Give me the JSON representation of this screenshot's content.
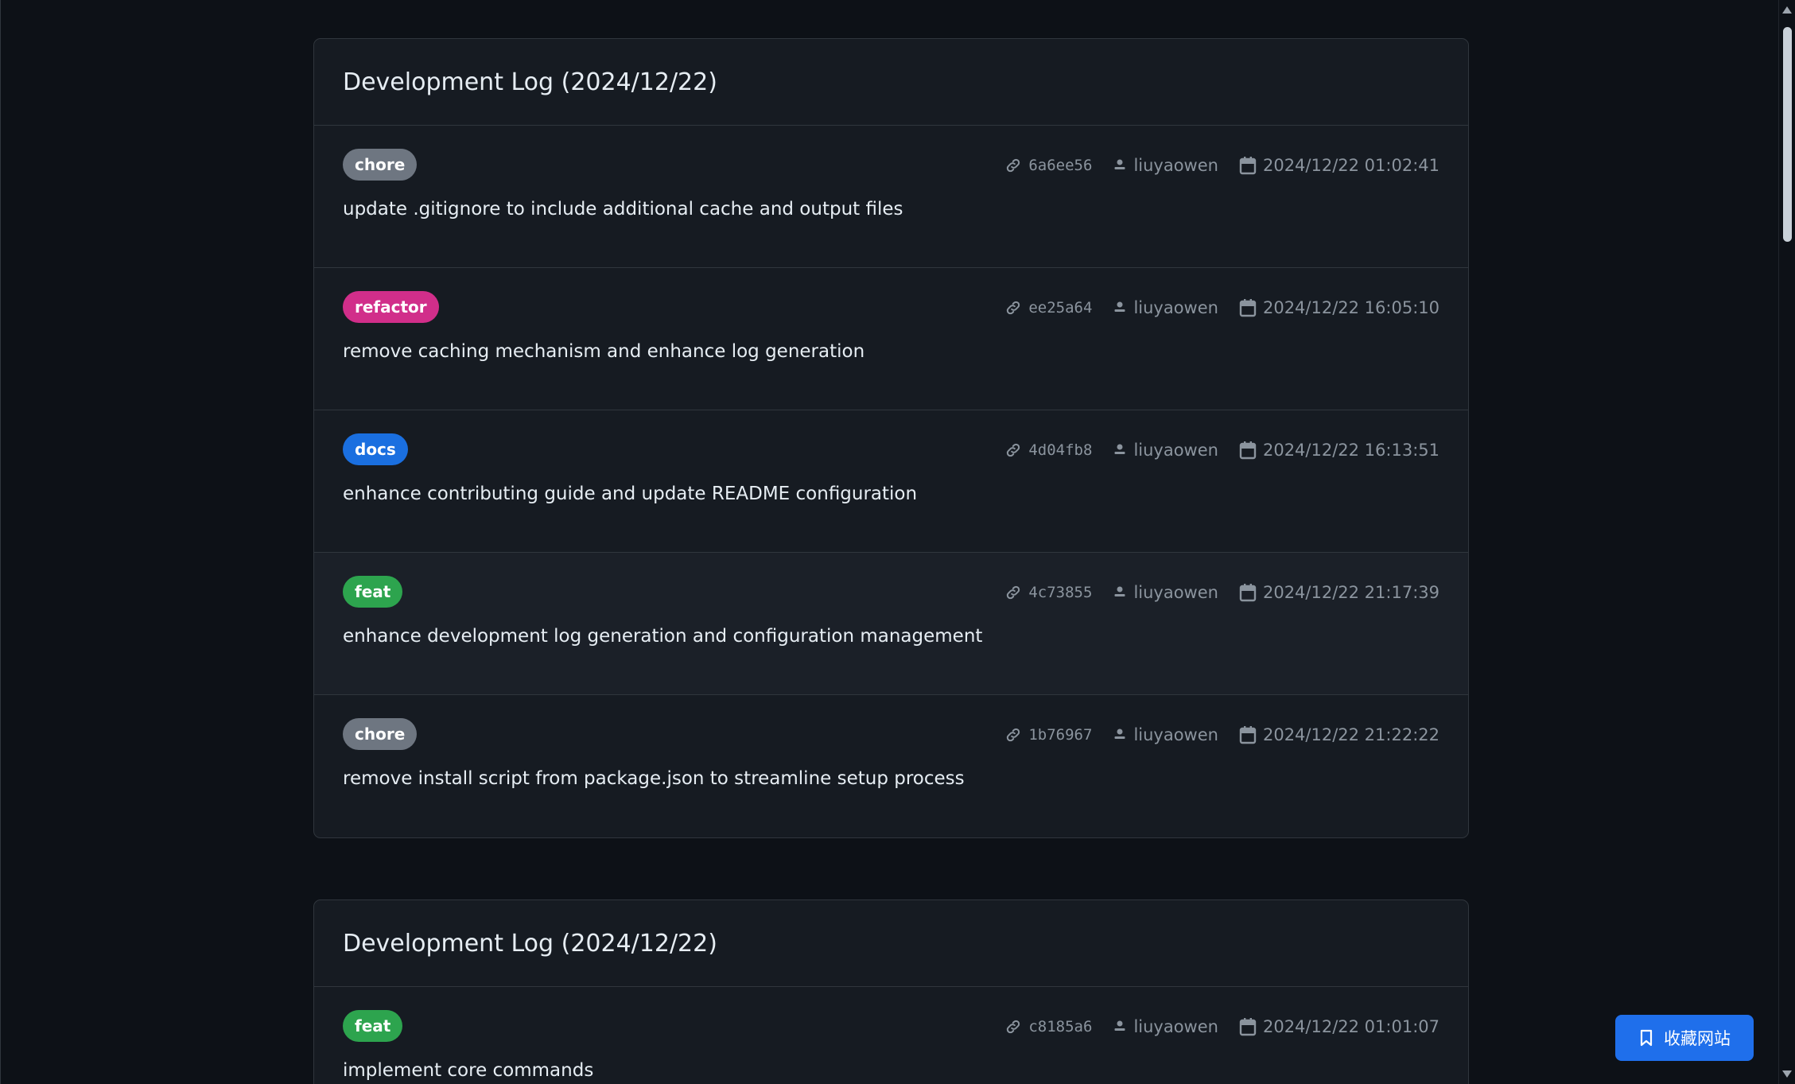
{
  "tag_colors": {
    "chore": "#6e7681",
    "refactor": "#d12e8a",
    "docs": "#1a6fe0",
    "feat": "#2da44e"
  },
  "logs": [
    {
      "title": "Development Log (2024/12/22)",
      "entries": [
        {
          "tag": "chore",
          "hash": "6a6ee56",
          "author": "liuyaowen",
          "date": "2024/12/22 01:02:41",
          "message": "update .gitignore to include additional cache and output files"
        },
        {
          "tag": "refactor",
          "hash": "ee25a64",
          "author": "liuyaowen",
          "date": "2024/12/22 16:05:10",
          "message": "remove caching mechanism and enhance log generation"
        },
        {
          "tag": "docs",
          "hash": "4d04fb8",
          "author": "liuyaowen",
          "date": "2024/12/22 16:13:51",
          "message": "enhance contributing guide and update README configuration"
        },
        {
          "tag": "feat",
          "hash": "4c73855",
          "author": "liuyaowen",
          "date": "2024/12/22 21:17:39",
          "message": "enhance development log generation and configuration management"
        },
        {
          "tag": "chore",
          "hash": "1b76967",
          "author": "liuyaowen",
          "date": "2024/12/22 21:22:22",
          "message": "remove install script from package.json to streamline setup process"
        }
      ]
    },
    {
      "title": "Development Log (2024/12/22)",
      "entries": [
        {
          "tag": "feat",
          "hash": "c8185a6",
          "author": "liuyaowen",
          "date": "2024/12/22 01:01:07",
          "message": "implement core commands"
        }
      ]
    }
  ],
  "fav_button": {
    "label": "收藏网站",
    "icon": "bookmark-icon"
  }
}
